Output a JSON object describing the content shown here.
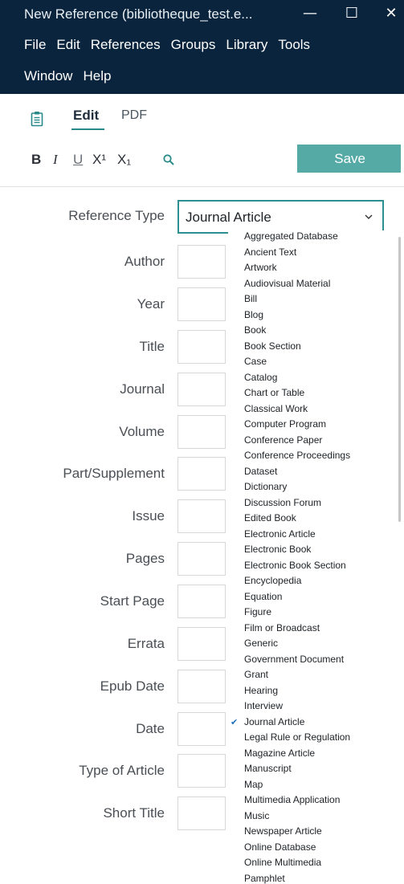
{
  "window": {
    "title": "New Reference (bibliotheque_test.e...",
    "min_glyph": "—",
    "max_glyph": "☐",
    "close_glyph": "✕"
  },
  "menu": {
    "row1": [
      "File",
      "Edit",
      "References",
      "Groups",
      "Library",
      "Tools"
    ],
    "row2": [
      "Window",
      "Help"
    ]
  },
  "tabs": {
    "edit": "Edit",
    "pdf": "PDF"
  },
  "format": {
    "bold": "B",
    "italic": "I",
    "underline": "U",
    "superscript": "X¹",
    "subscript": "X₁"
  },
  "toolbar": {
    "save_label": "Save"
  },
  "colors": {
    "header_bg": "#09243c",
    "accent": "#2d8f8f",
    "save_bg": "#55aaa6"
  },
  "form": {
    "reference_type_label": "Reference Type",
    "reference_type_value": "Journal Article",
    "fields": [
      "Author",
      "Year",
      "Title",
      "Journal",
      "Volume",
      "Part/Supplement",
      "Issue",
      "Pages",
      "Start Page",
      "Errata",
      "Epub Date",
      "Date",
      "Type of Article",
      "Short Title"
    ]
  },
  "dropdown": {
    "selected": "Journal Article",
    "options": [
      "Aggregated Database",
      "Ancient Text",
      "Artwork",
      "Audiovisual Material",
      "Bill",
      "Blog",
      "Book",
      "Book Section",
      "Case",
      "Catalog",
      "Chart or Table",
      "Classical Work",
      "Computer Program",
      "Conference Paper",
      "Conference Proceedings",
      "Dataset",
      "Dictionary",
      "Discussion Forum",
      "Edited Book",
      "Electronic Article",
      "Electronic Book",
      "Electronic Book Section",
      "Encyclopedia",
      "Equation",
      "Figure",
      "Film or Broadcast",
      "Generic",
      "Government Document",
      "Grant",
      "Hearing",
      "Interview",
      "Journal Article",
      "Legal Rule or Regulation",
      "Magazine Article",
      "Manuscript",
      "Map",
      "Multimedia Application",
      "Music",
      "Newspaper Article",
      "Online Database",
      "Online Multimedia",
      "Pamphlet"
    ]
  }
}
